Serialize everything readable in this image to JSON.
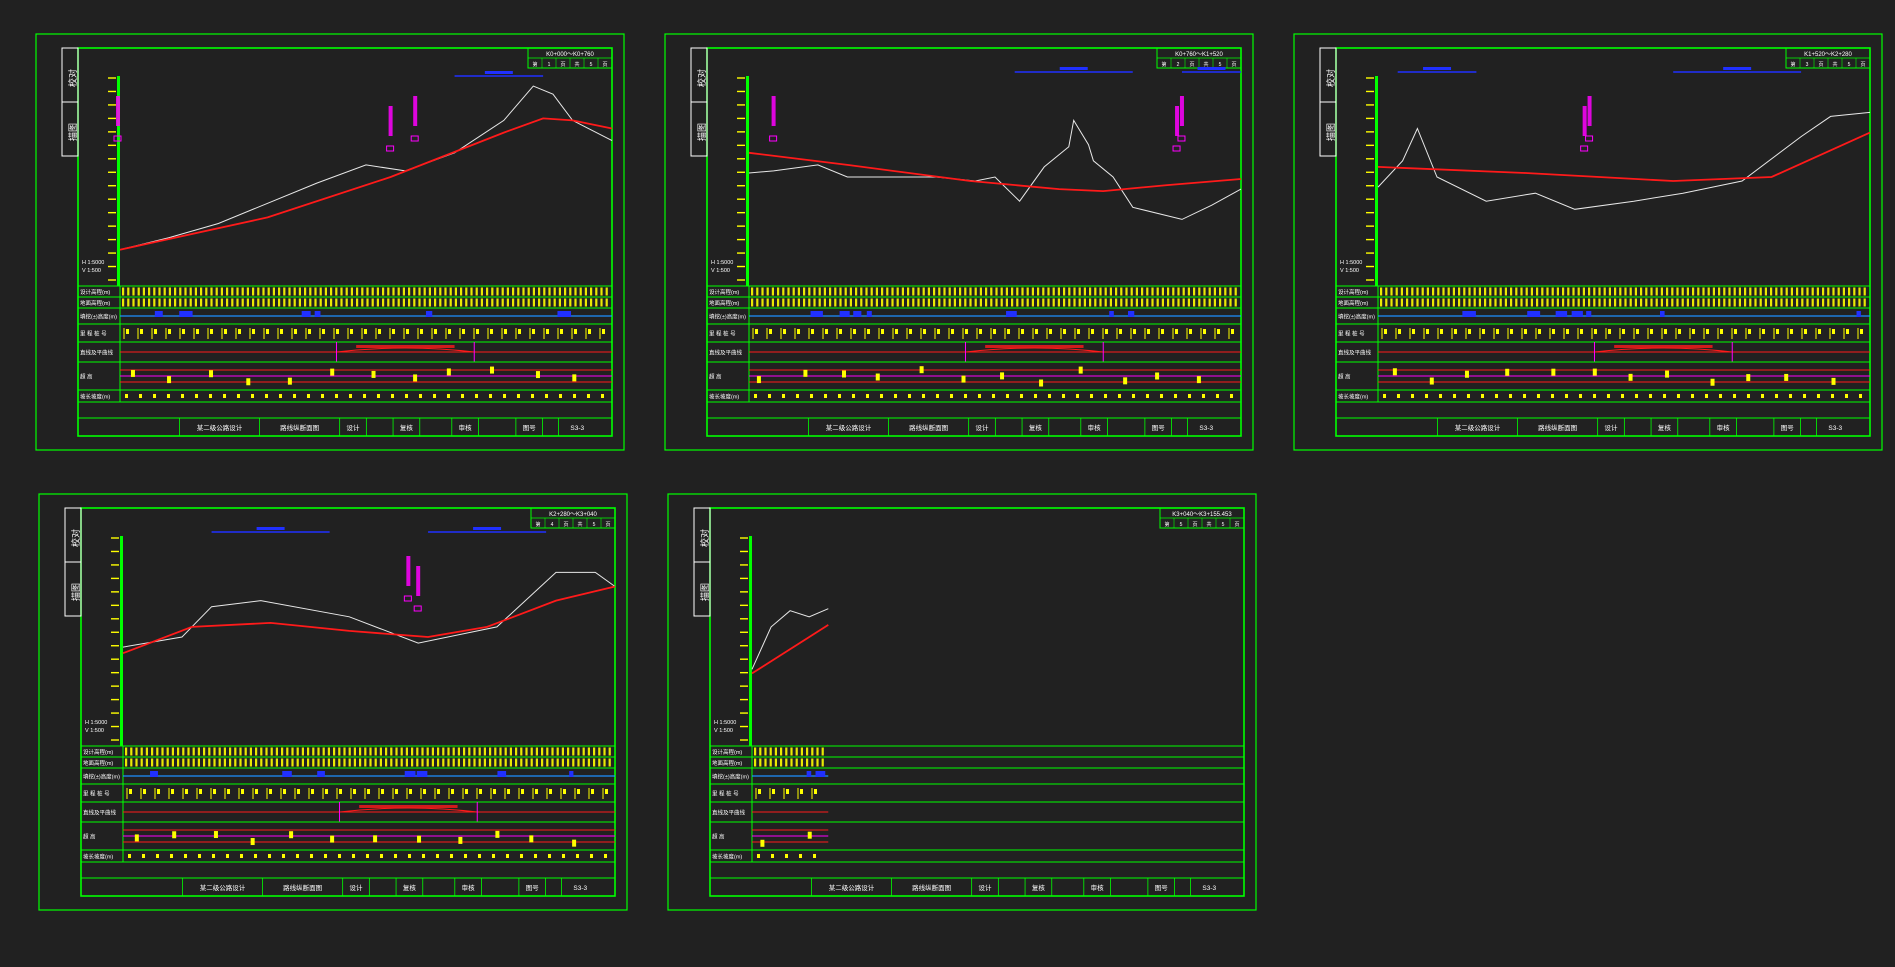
{
  "colors": {
    "background": "#212121",
    "frame": "#00ff00",
    "ground_line": "#e8e8e8",
    "design_line": "#ff1a1a",
    "annotation": "#ff00ff",
    "curve_marker": "#2030ff",
    "table_text": "#ffff00",
    "cyan_line": "#1e90ff"
  },
  "common": {
    "side_label_top": "校对",
    "side_label_bottom": "描图",
    "row_labels": [
      "设计高程(m)",
      "地面高程(m)",
      "填挖(±)高度(m)",
      "里 程 桩 号",
      "直线及平曲线",
      "超 高",
      "坡长坡度(m)"
    ],
    "title_block": {
      "project": "某二级公路设计",
      "drawing_name": "路线纵断面图",
      "design": "设计",
      "review": "复核",
      "audit": "审核",
      "drawing_no_label": "图号",
      "drawing_no": "S3-3"
    },
    "sheet_header": {
      "page_word": "第",
      "page_suffix": "页",
      "total_word": "共",
      "total_suffix": "页"
    }
  },
  "sheets": [
    {
      "id": 1,
      "range_label": "K0+000～K0+760",
      "page": "1",
      "total": "5",
      "scale_h": "H 1:5000",
      "scale_v": "V 1:500"
    },
    {
      "id": 2,
      "range_label": "K0+760～K1+520",
      "page": "2",
      "total": "5",
      "scale_h": "H 1:5000",
      "scale_v": "V 1:500"
    },
    {
      "id": 3,
      "range_label": "K1+520～K2+280",
      "page": "3",
      "total": "5",
      "scale_h": "H 1:5000",
      "scale_v": "V 1:500"
    },
    {
      "id": 4,
      "range_label": "K2+280～K3+040",
      "page": "4",
      "total": "5",
      "scale_h": "H 1:5000",
      "scale_v": "V 1:500"
    },
    {
      "id": 5,
      "range_label": "K3+040～K3+155.453",
      "page": "5",
      "total": "5",
      "scale_h": "H 1:5000",
      "scale_v": "V 1:500"
    }
  ]
}
